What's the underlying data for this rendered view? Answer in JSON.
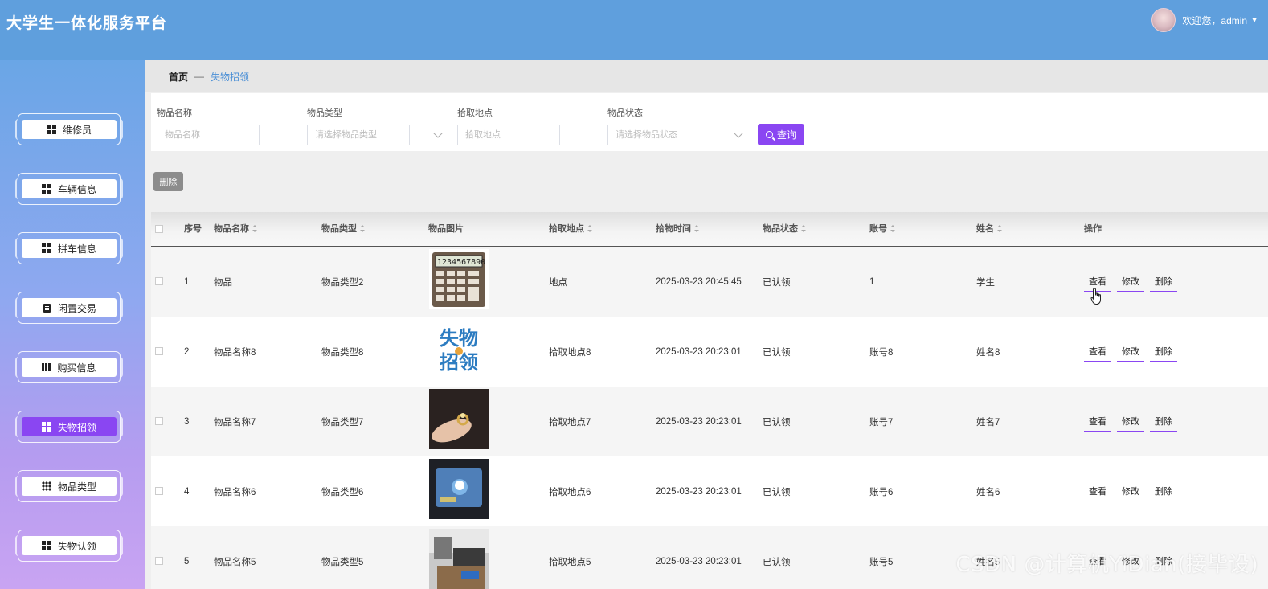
{
  "app": {
    "title": "大学生一体化服务平台"
  },
  "user": {
    "greeting": "欢迎您，admin"
  },
  "sidebar": {
    "items": [
      {
        "label": "维修员",
        "icon": "grid-icon",
        "active": false
      },
      {
        "label": "车辆信息",
        "icon": "grid-icon",
        "active": false
      },
      {
        "label": "拼车信息",
        "icon": "grid-icon",
        "active": false
      },
      {
        "label": "闲置交易",
        "icon": "document-icon",
        "active": false
      },
      {
        "label": "购买信息",
        "icon": "book-icon",
        "active": false
      },
      {
        "label": "失物招领",
        "icon": "grid-icon",
        "active": true
      },
      {
        "label": "物品类型",
        "icon": "dots-grid-icon",
        "active": false
      },
      {
        "label": "失物认领",
        "icon": "grid-icon",
        "active": false
      }
    ]
  },
  "breadcrumb": {
    "home": "首页",
    "separator": "—",
    "current": "失物招领"
  },
  "search": {
    "fields": [
      {
        "label": "物品名称",
        "placeholder": "物品名称",
        "type": "input"
      },
      {
        "label": "物品类型",
        "placeholder": "请选择物品类型",
        "type": "select"
      },
      {
        "label": "拾取地点",
        "placeholder": "拾取地点",
        "type": "input"
      },
      {
        "label": "物品状态",
        "placeholder": "请选择物品状态",
        "type": "select"
      }
    ],
    "query_label": "查询"
  },
  "toolbar": {
    "delete_label": "删除"
  },
  "table": {
    "columns": [
      "序号",
      "物品名称",
      "物品类型",
      "物品图片",
      "拾取地点",
      "拾物时间",
      "物品状态",
      "账号",
      "姓名",
      "操作"
    ],
    "rows": [
      {
        "index": "1",
        "name": "物品",
        "type": "物品类型2",
        "image": "calculator",
        "place": "地点",
        "time": "2025-03-23 20:45:45",
        "status": "已认领",
        "account": "1",
        "person": "学生"
      },
      {
        "index": "2",
        "name": "物品名称8",
        "type": "物品类型8",
        "image": "lost-found-logo",
        "place": "拾取地点8",
        "time": "2025-03-23 20:23:01",
        "status": "已认领",
        "account": "账号8",
        "person": "姓名8"
      },
      {
        "index": "3",
        "name": "物品名称7",
        "type": "物品类型7",
        "image": "ring-in-hand",
        "place": "拾取地点7",
        "time": "2025-03-23 20:23:01",
        "status": "已认领",
        "account": "账号7",
        "person": "姓名7"
      },
      {
        "index": "4",
        "name": "物品名称6",
        "type": "物品类型6",
        "image": "card",
        "place": "拾取地点6",
        "time": "2025-03-23 20:23:01",
        "status": "已认领",
        "account": "账号6",
        "person": "姓名6"
      },
      {
        "index": "5",
        "name": "物品名称5",
        "type": "物品类型5",
        "image": "misc-photo",
        "place": "拾取地点5",
        "time": "2025-03-23 20:23:01",
        "status": "已认领",
        "account": "账号5",
        "person": "姓名5"
      }
    ],
    "actions": {
      "view": "查看",
      "edit": "修改",
      "delete": "删除"
    }
  },
  "watermark": "CSDN @计算机YiDian(接毕设)",
  "colors": {
    "topbar": "#5f9fdd",
    "accent": "#8a46f2",
    "link": "#4a8fd6"
  }
}
